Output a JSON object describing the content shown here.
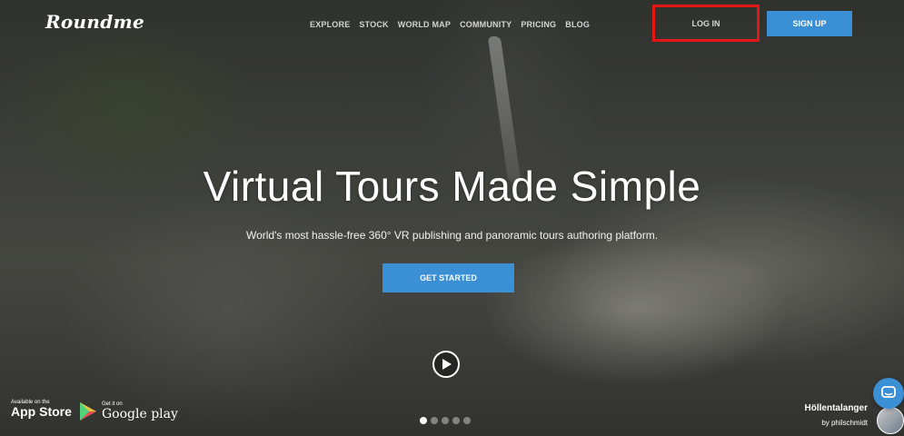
{
  "header": {
    "logo": "Roundme",
    "nav": [
      "EXPLORE",
      "STOCK",
      "WORLD MAP",
      "COMMUNITY",
      "PRICING",
      "BLOG"
    ],
    "login": "LOG IN",
    "signup": "SIGN UP"
  },
  "hero": {
    "headline": "Virtual Tours Made Simple",
    "subline": "World's most hassle-free 360° VR publishing and panoramic tours authoring platform.",
    "cta": "GET STARTED",
    "play_icon": "play-icon"
  },
  "stores": {
    "appstore_small": "Available on the",
    "appstore_big": "App Store",
    "google_small": "Get it on",
    "google_big": "Google play"
  },
  "carousel": {
    "count": 5,
    "active": 1
  },
  "credit": {
    "place": "Höllentalanger",
    "author": "by philschmidt"
  },
  "colors": {
    "accent": "#3b8fd4",
    "highlight": "#e41616"
  }
}
